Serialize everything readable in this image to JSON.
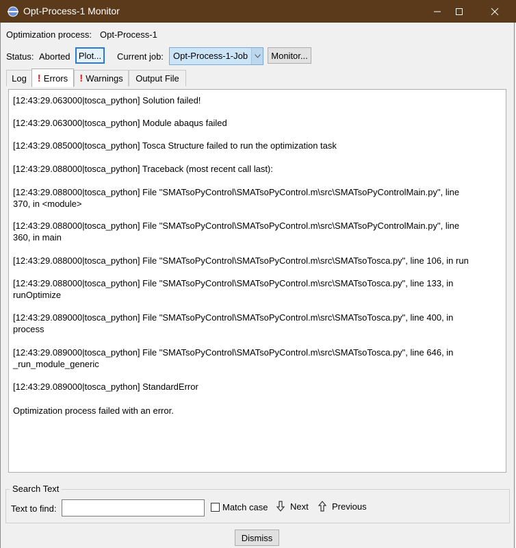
{
  "window": {
    "title": "Opt-Process-1 Monitor"
  },
  "header": {
    "process_label": "Optimization process:",
    "process_value": "Opt-Process-1",
    "status_label": "Status:",
    "status_value": "Aborted",
    "plot_button": "Plot...",
    "current_job_label": "Current job:",
    "current_job_value": "Opt-Process-1-Job",
    "monitor_button": "Monitor..."
  },
  "tabs": [
    {
      "label": "Log",
      "warning": false,
      "active": false
    },
    {
      "label": "Errors",
      "warning": true,
      "active": true
    },
    {
      "label": "Warnings",
      "warning": true,
      "active": false
    },
    {
      "label": "Output File",
      "warning": false,
      "active": false
    }
  ],
  "log": [
    "[12:43:29.063000|tosca_python] Solution failed!",
    "[12:43:29.063000|tosca_python] Module abaqus failed",
    "[12:43:29.085000|tosca_python] Tosca Structure failed to run the optimization task",
    "[12:43:29.088000|tosca_python] Traceback (most recent call last):",
    "[12:43:29.088000|tosca_python]   File \"SMATsoPyControl\\SMATsoPyControl.m\\src\\SMATsoPyControlMain.py\", line",
    "370, in <module>",
    "[12:43:29.088000|tosca_python]   File \"SMATsoPyControl\\SMATsoPyControl.m\\src\\SMATsoPyControlMain.py\", line",
    "360, in main",
    "[12:43:29.088000|tosca_python]   File \"SMATsoPyControl\\SMATsoPyControl.m\\src\\SMATsoTosca.py\", line 106, in run",
    "[12:43:29.088000|tosca_python]   File \"SMATsoPyControl\\SMATsoPyControl.m\\src\\SMATsoTosca.py\", line 133, in",
    "runOptimize",
    "[12:43:29.089000|tosca_python]   File \"SMATsoPyControl\\SMATsoPyControl.m\\src\\SMATsoTosca.py\", line 400, in",
    "process",
    "[12:43:29.089000|tosca_python]   File \"SMATsoPyControl\\SMATsoPyControl.m\\src\\SMATsoTosca.py\", line 646, in",
    "_run_module_generic",
    "[12:43:29.089000|tosca_python] StandardError",
    "Optimization process failed with an error."
  ],
  "search": {
    "group_title": "Search Text",
    "find_label": "Text to find:",
    "find_value": "",
    "match_case_label": "Match case",
    "next_label": "Next",
    "previous_label": "Previous"
  },
  "footer": {
    "dismiss_button": "Dismiss"
  },
  "colors": {
    "titlebar": "#5a3a1a",
    "error_mark": "#e02020",
    "focus_accent": "#2a7ad5"
  }
}
